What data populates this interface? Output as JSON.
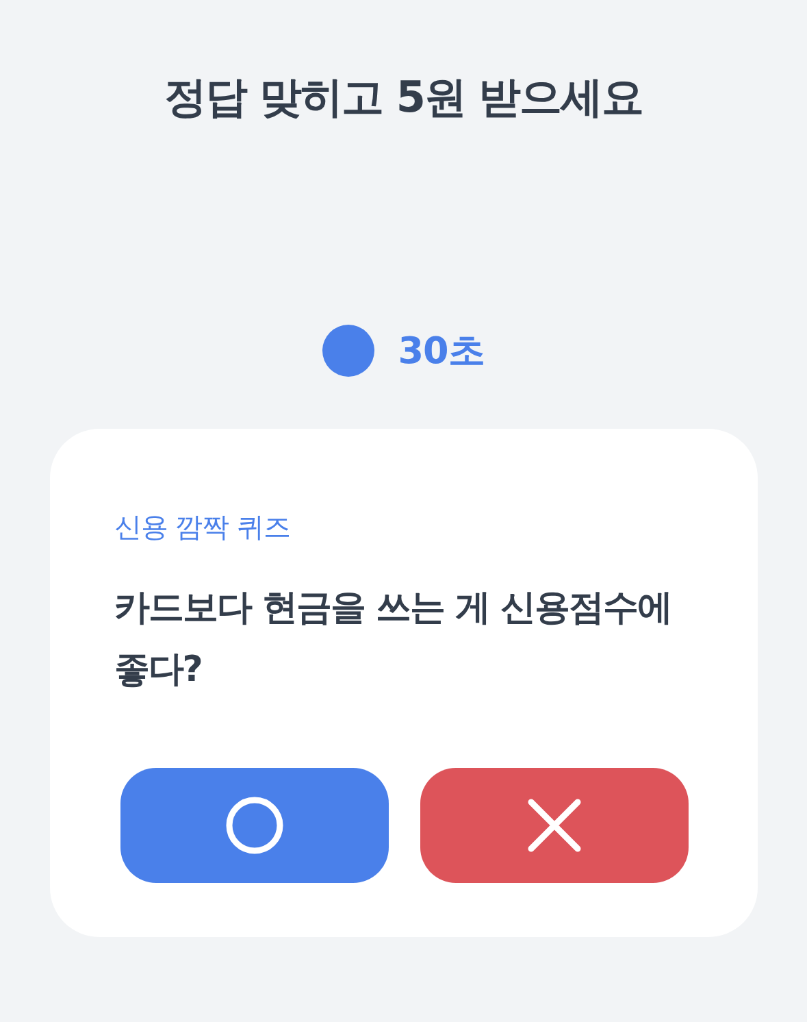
{
  "title": "정답 맞히고 5원 받으세요",
  "timer": {
    "label": "30초"
  },
  "quiz": {
    "category": "신용 깜짝 퀴즈",
    "question": "카드보다 현금을 쓰는 게 신용점수에 좋다?",
    "answers": [
      {
        "kind": "o"
      },
      {
        "kind": "x"
      }
    ]
  }
}
